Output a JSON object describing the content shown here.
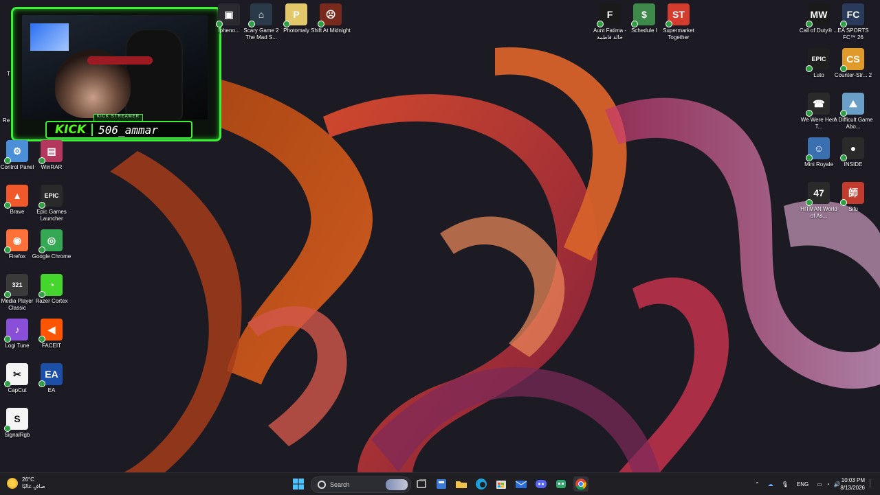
{
  "desktop": {
    "left_icons": [
      {
        "label": "Control Panel",
        "color": "#4a8fd8",
        "glyph": "⚙"
      },
      {
        "label": "WinRAR",
        "color": "#b4385e",
        "glyph": "▤"
      },
      {
        "label": "Brave",
        "color": "#f1592a",
        "glyph": "▲"
      },
      {
        "label": "Epic Games Launcher",
        "color": "#2a2a2a",
        "glyph": "EPIC"
      },
      {
        "label": "Firefox",
        "color": "#ff7139",
        "glyph": "◉"
      },
      {
        "label": "Google Chrome",
        "color": "#34a853",
        "glyph": "◎"
      },
      {
        "label": "Media Player Classic",
        "color": "#3a3a3a",
        "glyph": "321"
      },
      {
        "label": "Razer Cortex",
        "color": "#44d62c",
        "glyph": "◔"
      },
      {
        "label": "Logi Tune",
        "color": "#8a4fd8",
        "glyph": "♪"
      },
      {
        "label": "FACEIT",
        "color": "#ff5500",
        "glyph": "◀"
      },
      {
        "label": "CapCut",
        "color": "#f5f5f5",
        "glyph": "✂"
      },
      {
        "label": "EA",
        "color": "#1b4fa8",
        "glyph": "EA"
      },
      {
        "label": "SignalRgb",
        "color": "#f5f5f5",
        "glyph": "S"
      }
    ],
    "left_partial_labels": [
      "T",
      "Re"
    ],
    "top_icons": [
      {
        "label": "Ipheno...",
        "color": "#2a2a30",
        "glyph": "▣"
      },
      {
        "label": "Scary Game 2 The Mad S...",
        "color": "#2b3a48",
        "glyph": "⌂"
      },
      {
        "label": "Photomaly",
        "color": "#e3c86a",
        "glyph": "P"
      },
      {
        "label": "Shift At Midnight",
        "color": "#7a2a1d",
        "glyph": "☹"
      },
      {
        "label": "Aunt Fatima - خالة فاطمة",
        "color": "#1a1a1a",
        "glyph": "F"
      },
      {
        "label": "Schedule I",
        "color": "#3d8a4b",
        "glyph": "$"
      },
      {
        "label": "Supermarket Together",
        "color": "#d43c2e",
        "glyph": "ST"
      }
    ],
    "right_icons": [
      {
        "label": "Call of Duty® ...",
        "color": "#1a1a1a",
        "glyph": "MW"
      },
      {
        "label": "EA SPORTS FC™ 26",
        "color": "#2a3a5a",
        "glyph": "FC"
      },
      {
        "label": "Luto",
        "color": "#1f1f1f",
        "glyph": "EPIC"
      },
      {
        "label": "Counter-Str... 2",
        "color": "#e09a2a",
        "glyph": "CS"
      },
      {
        "label": "We Were Here T...",
        "color": "#2a2a2a",
        "glyph": "☎"
      },
      {
        "label": "A Difficult Game Abo...",
        "color": "#6aa0c8",
        "glyph": "⛰"
      },
      {
        "label": "Mini Royale",
        "color": "#3a6fb0",
        "glyph": "☺"
      },
      {
        "label": "INSIDE",
        "color": "#2a2a2a",
        "glyph": "●"
      },
      {
        "label": "HITMAN World of As...",
        "color": "#2a2a2a",
        "glyph": "47"
      },
      {
        "label": "Sifu",
        "color": "#c23b2e",
        "glyph": "師"
      }
    ]
  },
  "overlay": {
    "streamer_tag": "KICK STREAMER",
    "brand": "KICK",
    "username": "506_ammar"
  },
  "taskbar": {
    "weather_temp": "26°C",
    "weather_desc": "صافٍ غالبًا",
    "search_placeholder": "Search",
    "language": "ENG",
    "time": "10:03 PM",
    "date": "8/13/2026"
  }
}
